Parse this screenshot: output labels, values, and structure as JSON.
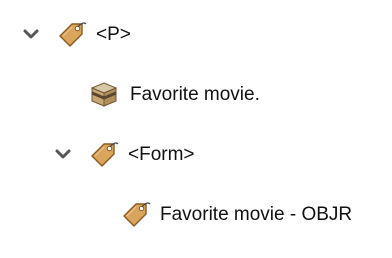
{
  "tree": {
    "nodes": [
      {
        "label": "<P>",
        "icon": "tag-icon",
        "expanded": true
      },
      {
        "label": "Favorite movie.",
        "icon": "box-icon"
      },
      {
        "label": "<Form>",
        "icon": "tag-icon",
        "expanded": true
      },
      {
        "label": "Favorite movie - OBJR",
        "icon": "tag-icon"
      }
    ]
  },
  "colors": {
    "tag_fill": "#D9A55C",
    "tag_stroke": "#8A5A22",
    "chevron": "#555555",
    "box_top": "#D8C9A6",
    "box_front": "#C7A874",
    "box_band": "#5B4630"
  }
}
